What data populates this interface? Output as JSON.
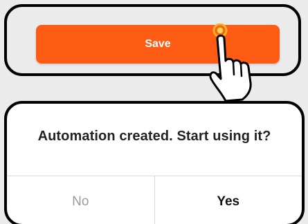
{
  "top_panel": {
    "save_label": "Save"
  },
  "dialog": {
    "message": "Automation created. Start using it?",
    "no_label": "No",
    "yes_label": "Yes"
  },
  "icons": {
    "tap_indicator": "hand-pointer-icon"
  },
  "colors": {
    "accent": "#fe5c14",
    "background": "#ebebeb",
    "dialog_bg": "#ffffff",
    "disabled_text": "#9a9a9a",
    "divider": "#d9d9d9"
  }
}
